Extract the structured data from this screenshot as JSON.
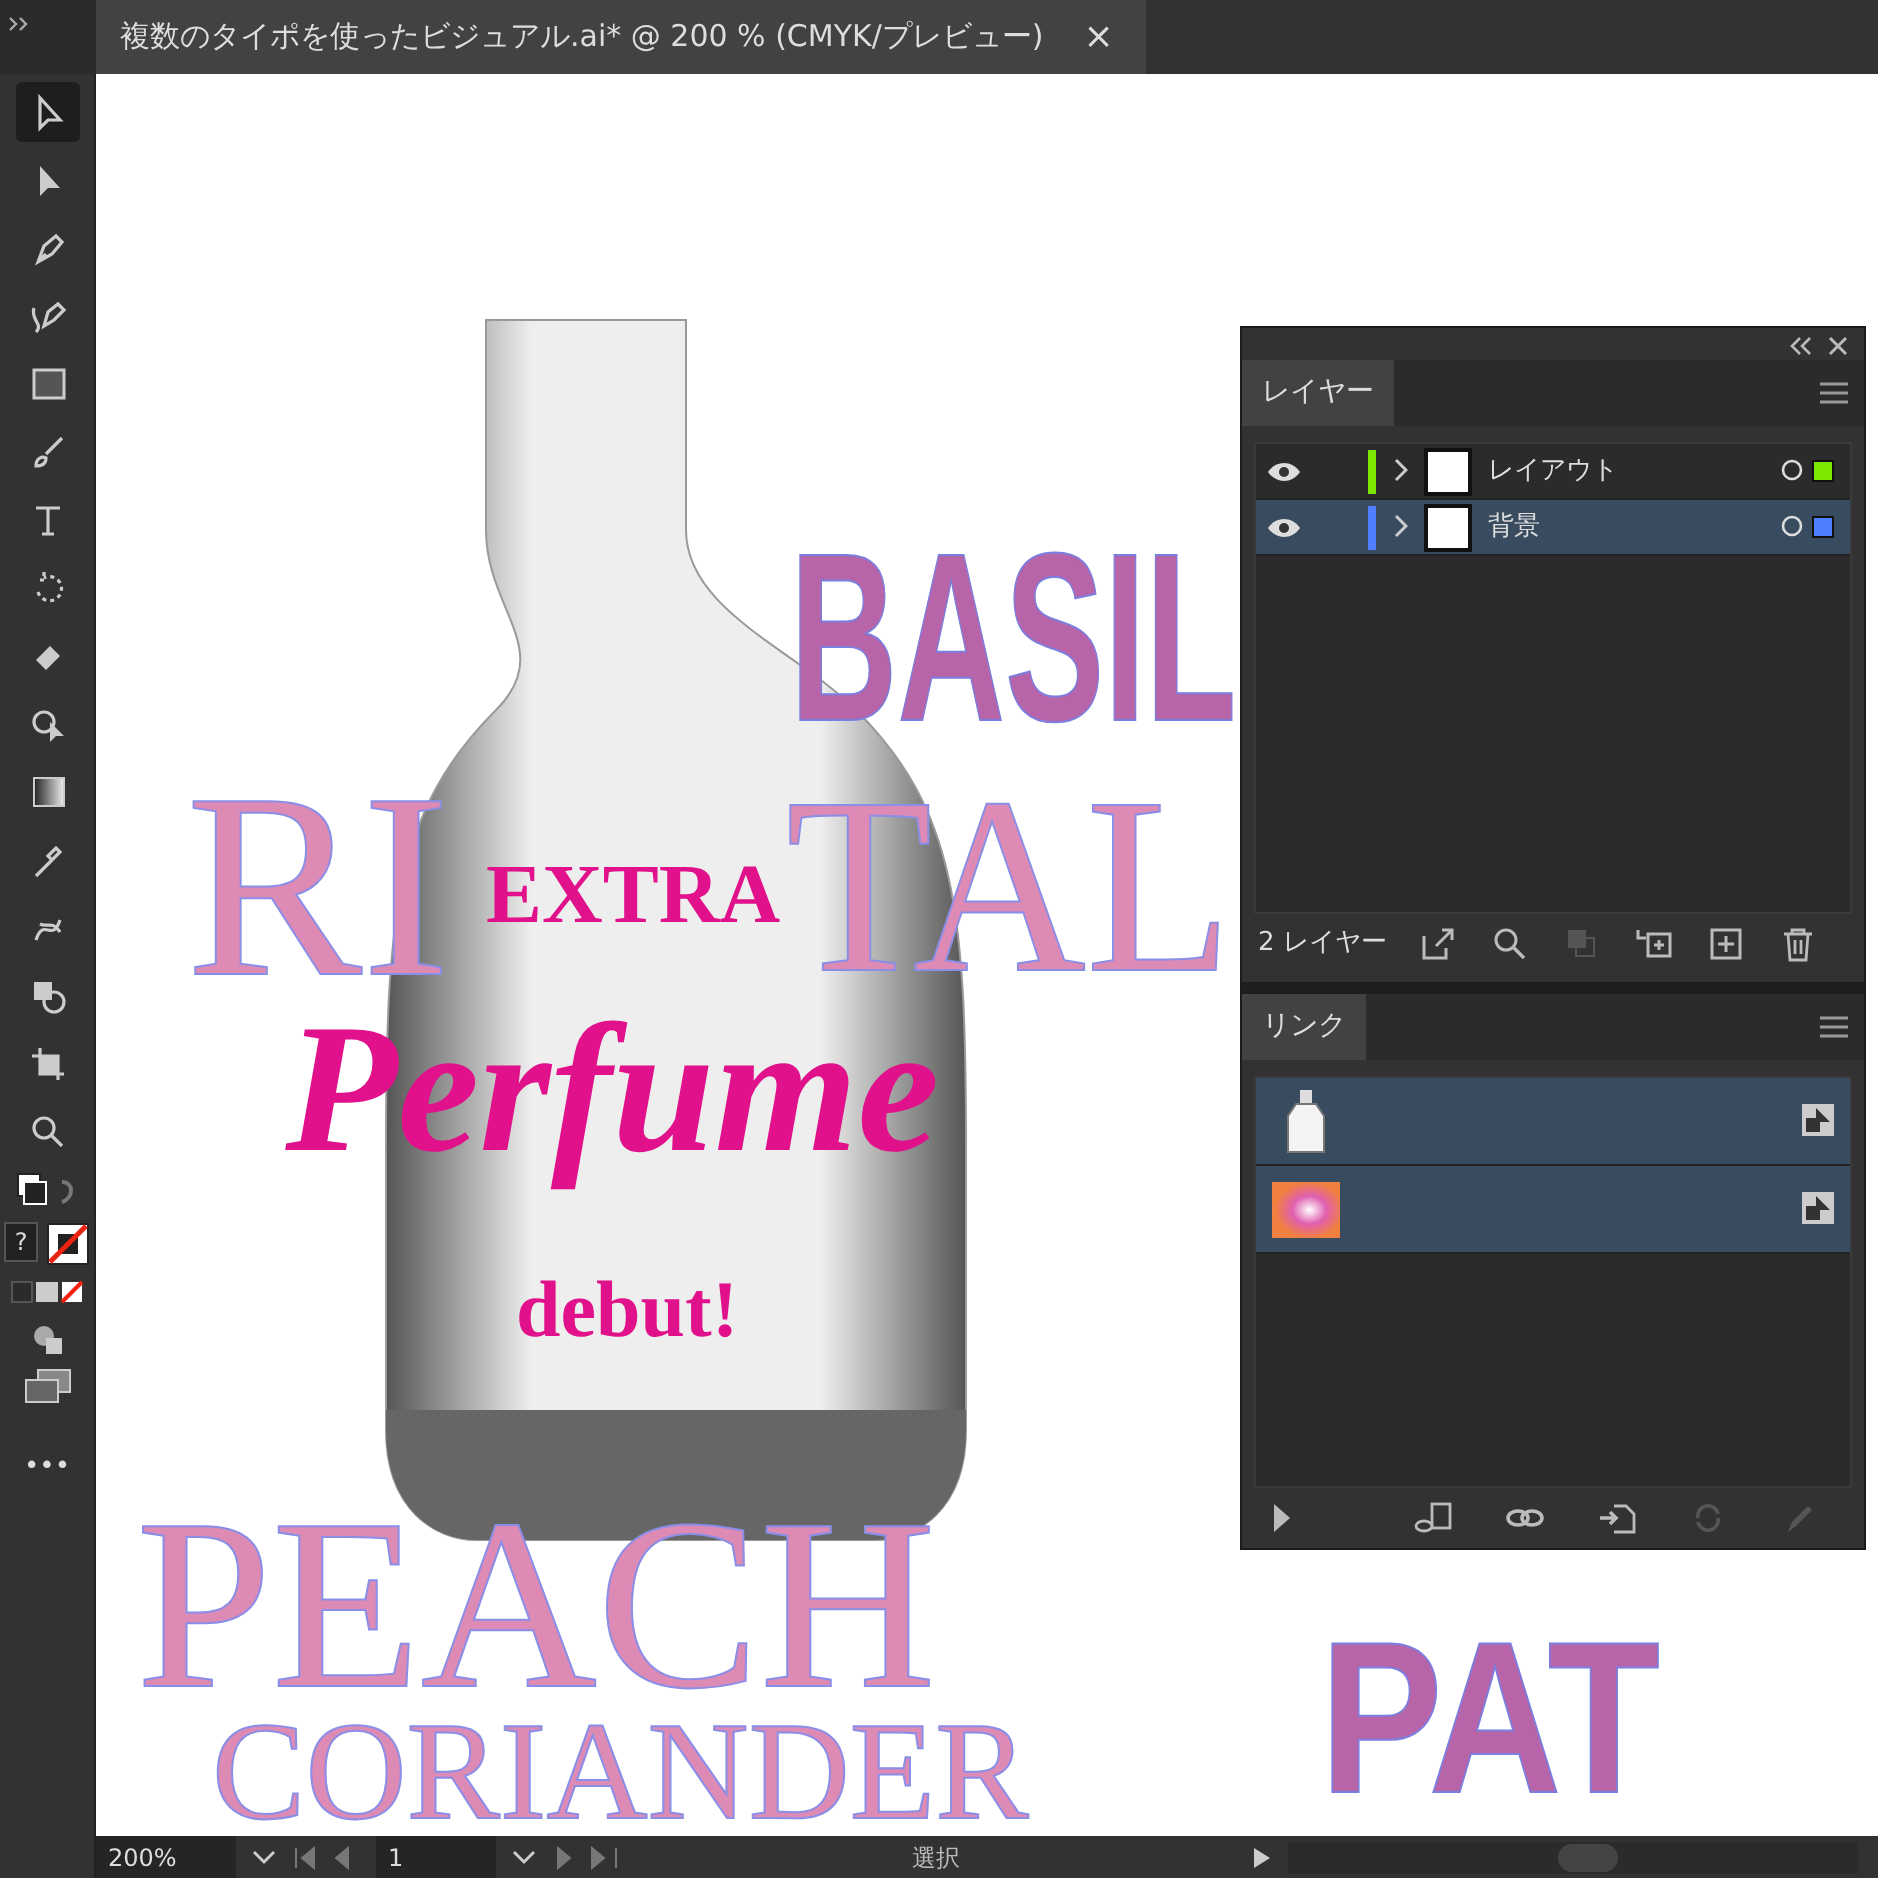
{
  "document_tab": {
    "title": "複数のタイポを使ったビジュアル.ai* @ 200 % (CMYK/プレビュー)",
    "close": "×"
  },
  "tools": [
    {
      "kind": "selection",
      "selected": true
    },
    {
      "kind": "direct",
      "selected": false
    },
    {
      "kind": "pen",
      "selected": false
    },
    {
      "kind": "curvature",
      "selected": false
    },
    {
      "kind": "rectangle",
      "selected": false
    },
    {
      "kind": "brush",
      "selected": false
    },
    {
      "kind": "type",
      "selected": false
    },
    {
      "kind": "rotate",
      "selected": false
    },
    {
      "kind": "eraser",
      "selected": false
    },
    {
      "kind": "shapebuilder",
      "selected": false
    },
    {
      "kind": "gradient",
      "selected": false
    },
    {
      "kind": "eyedropper",
      "selected": false
    },
    {
      "kind": "puppet",
      "selected": false
    },
    {
      "kind": "blend",
      "selected": false
    },
    {
      "kind": "artboard",
      "selected": false
    },
    {
      "kind": "zoom",
      "selected": false
    }
  ],
  "color_help": "?",
  "more_tools": "•••",
  "artwork": {
    "words": [
      {
        "text": "BASIL",
        "kind": "sans"
      },
      {
        "text": "RI",
        "kind": "serif"
      },
      {
        "text": "TAL",
        "kind": "serif"
      },
      {
        "text": "PEACH",
        "kind": "serif"
      },
      {
        "text": "CORIANDER",
        "kind": "serif"
      },
      {
        "text": "PAT",
        "kind": "sans"
      }
    ],
    "headline": {
      "top": "EXTRA",
      "main": "Perfume",
      "bottom": "debut!"
    }
  },
  "layers_panel": {
    "tab": "レイヤー",
    "layers": [
      {
        "name": "レイアウト",
        "color": "#7ee600",
        "visible": true,
        "selected": false
      },
      {
        "name": "背景",
        "color": "#4f7fff",
        "visible": true,
        "selected": true
      }
    ],
    "count": "2 レイヤー"
  },
  "links_panel": {
    "tab": "リンク",
    "links": [
      {
        "kind": "bottle",
        "selected": true
      },
      {
        "kind": "gradient",
        "selected": true
      }
    ]
  },
  "status_bar": {
    "zoom": "200%",
    "page": "1",
    "tool": "選択"
  }
}
